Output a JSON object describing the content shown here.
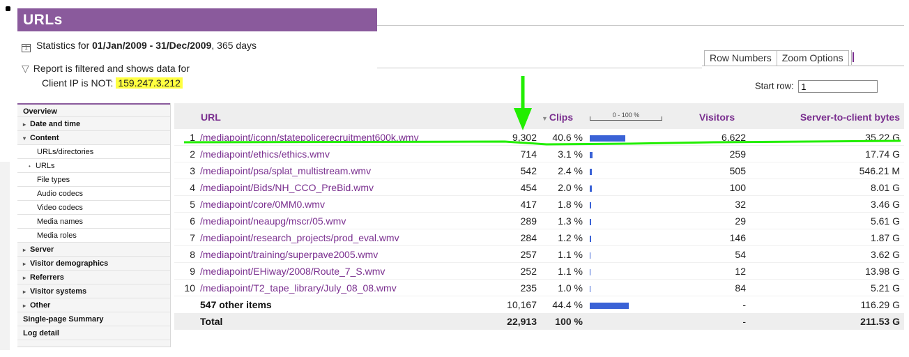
{
  "report": {
    "title": "URLs",
    "stats_prefix": "Statistics for ",
    "date_range": "01/Jan/2009 - 31/Dec/2009",
    "stats_suffix": ", 365 days",
    "calendar_glyph": "1",
    "filter_text": "Report is filtered and shows data for",
    "filter_condition": "Client IP is NOT:",
    "filter_ip": "159.247.3.212"
  },
  "tabs": [
    {
      "label": "Row Numbers"
    },
    {
      "label": "Zoom Options"
    }
  ],
  "start_row": {
    "label": "Start row:",
    "value": "1"
  },
  "sidebar": {
    "items": [
      {
        "label": "Overview",
        "marker": "",
        "type": "top",
        "bold": true
      },
      {
        "label": "Date and time",
        "marker": "▸",
        "type": "top",
        "bold": true
      },
      {
        "label": "Content",
        "marker": "▾",
        "type": "top",
        "bold": true
      },
      {
        "label": "URLs/directories",
        "marker": "",
        "type": "sub"
      },
      {
        "label": "URLs",
        "marker": "•",
        "type": "sub-active"
      },
      {
        "label": "File types",
        "marker": "",
        "type": "sub"
      },
      {
        "label": "Audio codecs",
        "marker": "",
        "type": "sub"
      },
      {
        "label": "Video codecs",
        "marker": "",
        "type": "sub"
      },
      {
        "label": "Media names",
        "marker": "",
        "type": "sub"
      },
      {
        "label": "Media roles",
        "marker": "",
        "type": "sub"
      },
      {
        "label": "Server",
        "marker": "▸",
        "type": "top",
        "bold": true
      },
      {
        "label": "Visitor demographics",
        "marker": "▸",
        "type": "top",
        "bold": true
      },
      {
        "label": "Referrers",
        "marker": "▸",
        "type": "top",
        "bold": true
      },
      {
        "label": "Visitor systems",
        "marker": "▸",
        "type": "top",
        "bold": true
      },
      {
        "label": "Other",
        "marker": "▸",
        "type": "top",
        "bold": true
      },
      {
        "label": "Single-page Summary",
        "marker": "",
        "type": "top",
        "bold": true
      },
      {
        "label": "Log detail",
        "marker": "",
        "type": "top",
        "bold": true
      }
    ]
  },
  "table": {
    "headers": {
      "url": "URL",
      "clips_sort_glyph": "▼",
      "clips": "Clips",
      "scale": "0 - 100 %",
      "visitors": "Visitors",
      "bytes": "Server-to-client bytes"
    },
    "rows": [
      {
        "num": "1",
        "url": "/mediapoint/iconn/statepolicerecruitment600k.wmv",
        "clips": "9,302",
        "pct": "40.6 %",
        "pct_value": 40.6,
        "visitors": "6,622",
        "bytes": "35.22 G"
      },
      {
        "num": "2",
        "url": "/mediapoint/ethics/ethics.wmv",
        "clips": "714",
        "pct": "3.1 %",
        "pct_value": 3.1,
        "visitors": "259",
        "bytes": "17.74 G"
      },
      {
        "num": "3",
        "url": "/mediapoint/psa/splat_multistream.wmv",
        "clips": "542",
        "pct": "2.4 %",
        "pct_value": 2.4,
        "visitors": "505",
        "bytes": "546.21 M"
      },
      {
        "num": "4",
        "url": "/mediapoint/Bids/NH_CCO_PreBid.wmv",
        "clips": "454",
        "pct": "2.0 %",
        "pct_value": 2.0,
        "visitors": "100",
        "bytes": "8.01 G"
      },
      {
        "num": "5",
        "url": "/mediapoint/core/0MM0.wmv",
        "clips": "417",
        "pct": "1.8 %",
        "pct_value": 1.8,
        "visitors": "32",
        "bytes": "3.46 G"
      },
      {
        "num": "6",
        "url": "/mediapoint/neaupg/mscr/05.wmv",
        "clips": "289",
        "pct": "1.3 %",
        "pct_value": 1.3,
        "visitors": "29",
        "bytes": "5.61 G"
      },
      {
        "num": "7",
        "url": "/mediapoint/research_projects/prod_eval.wmv",
        "clips": "284",
        "pct": "1.2 %",
        "pct_value": 1.2,
        "visitors": "146",
        "bytes": "1.87 G"
      },
      {
        "num": "8",
        "url": "/mediapoint/training/superpave2005.wmv",
        "clips": "257",
        "pct": "1.1 %",
        "pct_value": 1.1,
        "visitors": "54",
        "bytes": "3.62 G"
      },
      {
        "num": "9",
        "url": "/mediapoint/EHiway/2008/Route_7_S.wmv",
        "clips": "252",
        "pct": "1.1 %",
        "pct_value": 1.1,
        "visitors": "12",
        "bytes": "13.98 G"
      },
      {
        "num": "10",
        "url": "/mediapoint/T2_tape_library/July_08_08.wmv",
        "clips": "235",
        "pct": "1.0 %",
        "pct_value": 1.0,
        "visitors": "84",
        "bytes": "5.21 G"
      }
    ],
    "other": {
      "label": "547 other items",
      "clips": "10,167",
      "pct": "44.4 %",
      "pct_value": 44.4,
      "visitors": "-",
      "bytes": "116.29 G"
    },
    "total": {
      "label": "Total",
      "clips": "22,913",
      "pct": "100 %",
      "visitors": "-",
      "bytes": "211.53 G"
    }
  },
  "colors": {
    "title_bar": "#8a5a9c",
    "link": "#7a2f8f",
    "bar": "#3a62d6",
    "ip_highlight": "#ffff40",
    "annotation": "#22ee00"
  }
}
